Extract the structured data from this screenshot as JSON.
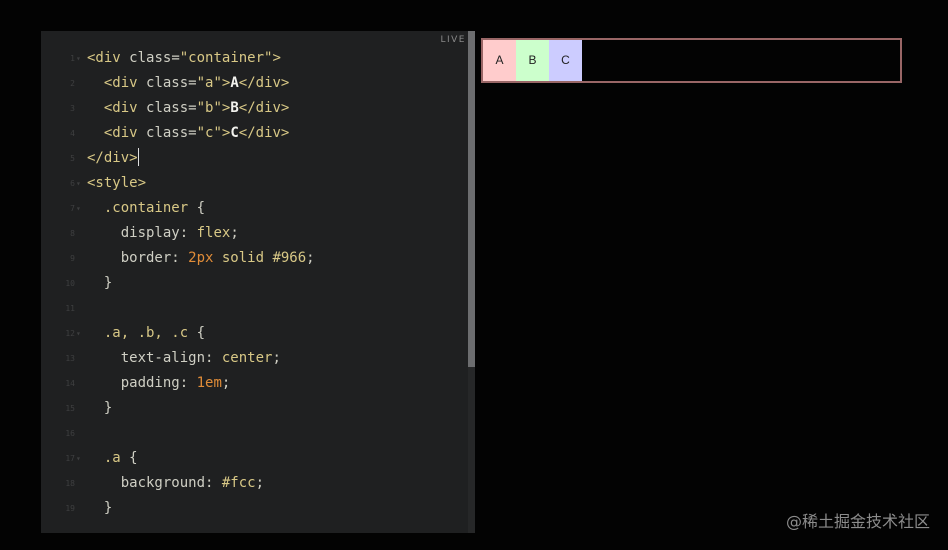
{
  "editor": {
    "live_label": "LIVE",
    "lines": [
      {
        "num": "1",
        "fold": "▾",
        "parts": [
          [
            "tag",
            "<div "
          ],
          [
            "attr",
            "class"
          ],
          [
            "punct",
            "="
          ],
          [
            "str",
            "\"container\""
          ],
          [
            "tag",
            ">"
          ]
        ]
      },
      {
        "num": "2",
        "fold": "",
        "parts": [
          [
            "punct",
            "  "
          ],
          [
            "tag",
            "<div "
          ],
          [
            "attr",
            "class"
          ],
          [
            "punct",
            "="
          ],
          [
            "str",
            "\"a\""
          ],
          [
            "tag",
            ">"
          ],
          [
            "txt",
            "A"
          ],
          [
            "tag",
            "</div>"
          ]
        ]
      },
      {
        "num": "3",
        "fold": "",
        "parts": [
          [
            "punct",
            "  "
          ],
          [
            "tag",
            "<div "
          ],
          [
            "attr",
            "class"
          ],
          [
            "punct",
            "="
          ],
          [
            "str",
            "\"b\""
          ],
          [
            "tag",
            ">"
          ],
          [
            "txt",
            "B"
          ],
          [
            "tag",
            "</div>"
          ]
        ]
      },
      {
        "num": "4",
        "fold": "",
        "parts": [
          [
            "punct",
            "  "
          ],
          [
            "tag",
            "<div "
          ],
          [
            "attr",
            "class"
          ],
          [
            "punct",
            "="
          ],
          [
            "str",
            "\"c\""
          ],
          [
            "tag",
            ">"
          ],
          [
            "txt",
            "C"
          ],
          [
            "tag",
            "</div>"
          ]
        ]
      },
      {
        "num": "5",
        "fold": "",
        "parts": [
          [
            "tag",
            "</div>"
          ]
        ],
        "cursor": true
      },
      {
        "num": "6",
        "fold": "▾",
        "parts": [
          [
            "tag",
            "<style>"
          ]
        ]
      },
      {
        "num": "7",
        "fold": "▾",
        "parts": [
          [
            "punct",
            "  "
          ],
          [
            "sel",
            ".container"
          ],
          [
            "punct",
            " {"
          ]
        ]
      },
      {
        "num": "8",
        "fold": "",
        "parts": [
          [
            "punct",
            "    "
          ],
          [
            "prop",
            "display"
          ],
          [
            "punct",
            ": "
          ],
          [
            "val",
            "flex"
          ],
          [
            "punct",
            ";"
          ]
        ]
      },
      {
        "num": "9",
        "fold": "",
        "parts": [
          [
            "punct",
            "    "
          ],
          [
            "prop",
            "border"
          ],
          [
            "punct",
            ": "
          ],
          [
            "num",
            "2px"
          ],
          [
            "val",
            " solid #966"
          ],
          [
            "punct",
            ";"
          ]
        ]
      },
      {
        "num": "10",
        "fold": "",
        "parts": [
          [
            "punct",
            "  }"
          ]
        ]
      },
      {
        "num": "11",
        "fold": "",
        "parts": []
      },
      {
        "num": "12",
        "fold": "▾",
        "parts": [
          [
            "punct",
            "  "
          ],
          [
            "sel",
            ".a, .b, .c"
          ],
          [
            "punct",
            " {"
          ]
        ]
      },
      {
        "num": "13",
        "fold": "",
        "parts": [
          [
            "punct",
            "    "
          ],
          [
            "prop",
            "text-align"
          ],
          [
            "punct",
            ": "
          ],
          [
            "val",
            "center"
          ],
          [
            "punct",
            ";"
          ]
        ]
      },
      {
        "num": "14",
        "fold": "",
        "parts": [
          [
            "punct",
            "    "
          ],
          [
            "prop",
            "padding"
          ],
          [
            "punct",
            ": "
          ],
          [
            "num",
            "1em"
          ],
          [
            "punct",
            ";"
          ]
        ]
      },
      {
        "num": "15",
        "fold": "",
        "parts": [
          [
            "punct",
            "  }"
          ]
        ]
      },
      {
        "num": "16",
        "fold": "",
        "parts": []
      },
      {
        "num": "17",
        "fold": "▾",
        "parts": [
          [
            "punct",
            "  "
          ],
          [
            "sel",
            ".a"
          ],
          [
            "punct",
            " {"
          ]
        ]
      },
      {
        "num": "18",
        "fold": "",
        "parts": [
          [
            "punct",
            "    "
          ],
          [
            "prop",
            "background"
          ],
          [
            "punct",
            ": "
          ],
          [
            "val",
            "#fcc"
          ],
          [
            "punct",
            ";"
          ]
        ]
      },
      {
        "num": "19",
        "fold": "",
        "parts": [
          [
            "punct",
            "  }"
          ]
        ]
      }
    ]
  },
  "preview": {
    "boxes": [
      {
        "label": "A",
        "color": "#ffcccc"
      },
      {
        "label": "B",
        "color": "#ccffcc"
      },
      {
        "label": "C",
        "color": "#ccccff"
      }
    ],
    "border_color": "#996666"
  },
  "watermark": "@稀土掘金技术社区"
}
